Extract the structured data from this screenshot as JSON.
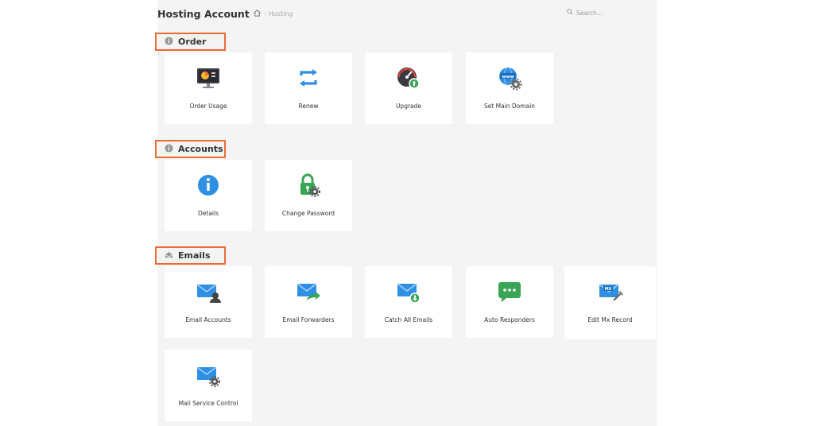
{
  "header": {
    "title": "Hosting Account",
    "breadcrumb": "Hosting",
    "search_placeholder": "Search..."
  },
  "sections": {
    "order": {
      "title": "Order",
      "items": [
        "Order Usage",
        "Renew",
        "Upgrade",
        "Set Main Domain"
      ]
    },
    "accounts": {
      "title": "Accounts",
      "items": [
        "Details",
        "Change Password"
      ]
    },
    "emails": {
      "title": "Emails",
      "items": [
        "Email Accounts",
        "Email Forwarders",
        "Catch All Emails",
        "Auto Responders",
        "Edit Mx Record",
        "Mail Service Control"
      ]
    }
  },
  "icons": {
    "order_usage": "monitor-chart-icon",
    "renew": "renew-arrows-icon",
    "upgrade": "speedometer-upgrade-icon",
    "set_main_domain": "www-globe-gear-icon",
    "details": "info-icon",
    "change_password": "lock-gear-icon",
    "email_accounts": "envelope-user-icon",
    "email_forwarders": "envelope-forward-icon",
    "catch_all": "envelope-download-icon",
    "auto_responders": "chat-bubble-icon",
    "edit_mx": "envelope-mx-icon",
    "mail_service": "envelope-gear-icon"
  },
  "colors": {
    "highlight": "#ec6b35",
    "blue": "#2f8fe3",
    "green": "#3aa655"
  }
}
